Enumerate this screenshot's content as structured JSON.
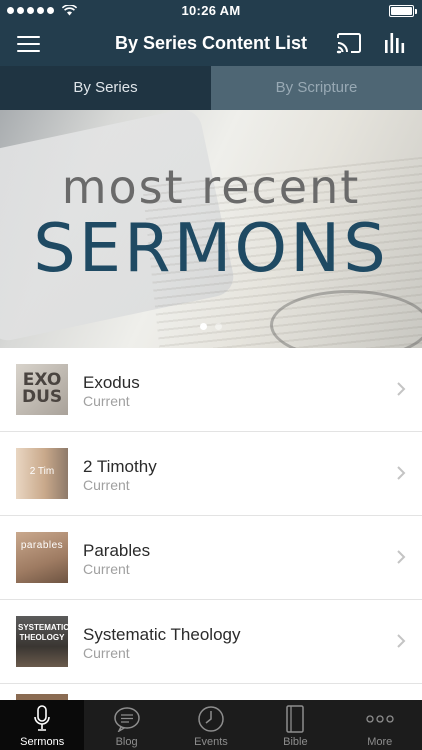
{
  "status_bar": {
    "time": "10:26 AM",
    "signal_dots": 5
  },
  "nav": {
    "title": "By Series Content List",
    "menu_icon": "hamburger-menu-icon",
    "cast_icon": "cast-icon",
    "stats_icon": "bar-chart-icon"
  },
  "segments": [
    {
      "label": "By Series",
      "selected": true
    },
    {
      "label": "By Scripture",
      "selected": false
    }
  ],
  "banner": {
    "line1": "most recent",
    "line2": "SERMONS",
    "page_count": 2,
    "current_page": 1
  },
  "series": [
    {
      "title": "Exodus",
      "subtitle": "Current",
      "thumb_text": "EXO DUS"
    },
    {
      "title": "2 Timothy",
      "subtitle": "Current",
      "thumb_text": "2 Tim"
    },
    {
      "title": "Parables",
      "subtitle": "Current",
      "thumb_text": "parables"
    },
    {
      "title": "Systematic Theology",
      "subtitle": "Current",
      "thumb_text": "SYSTEMATIC THEOLOGY"
    }
  ],
  "tabs": [
    {
      "label": "Sermons",
      "icon": "microphone-icon",
      "active": true
    },
    {
      "label": "Blog",
      "icon": "chat-bubble-icon",
      "active": false
    },
    {
      "label": "Events",
      "icon": "clock-icon",
      "active": false
    },
    {
      "label": "Bible",
      "icon": "book-icon",
      "active": false
    },
    {
      "label": "More",
      "icon": "ellipsis-icon",
      "active": false
    }
  ],
  "colors": {
    "nav_bg": "#233d4d",
    "tab_bar_bg": "#1c1c1c",
    "banner_title": "#1f4a63"
  }
}
